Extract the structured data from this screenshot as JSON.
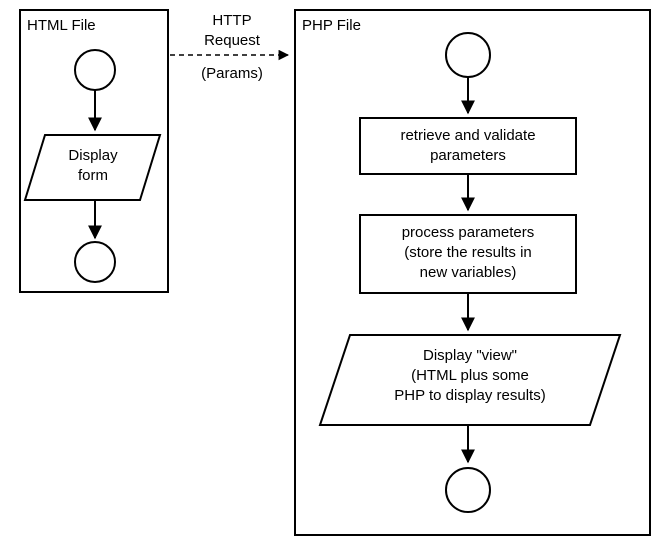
{
  "left": {
    "title": "HTML File",
    "step1": "Display",
    "step1b": "form"
  },
  "connector": {
    "line1": "HTTP",
    "line2": "Request",
    "line3": "(Params)"
  },
  "right": {
    "title": "PHP File",
    "box1a": "retrieve and validate",
    "box1b": "parameters",
    "box2a": "process parameters",
    "box2b": "(store the results in",
    "box2c": "new variables)",
    "box3a": "Display \"view\"",
    "box3b": "(HTML plus some",
    "box3c": "PHP to display results)"
  }
}
